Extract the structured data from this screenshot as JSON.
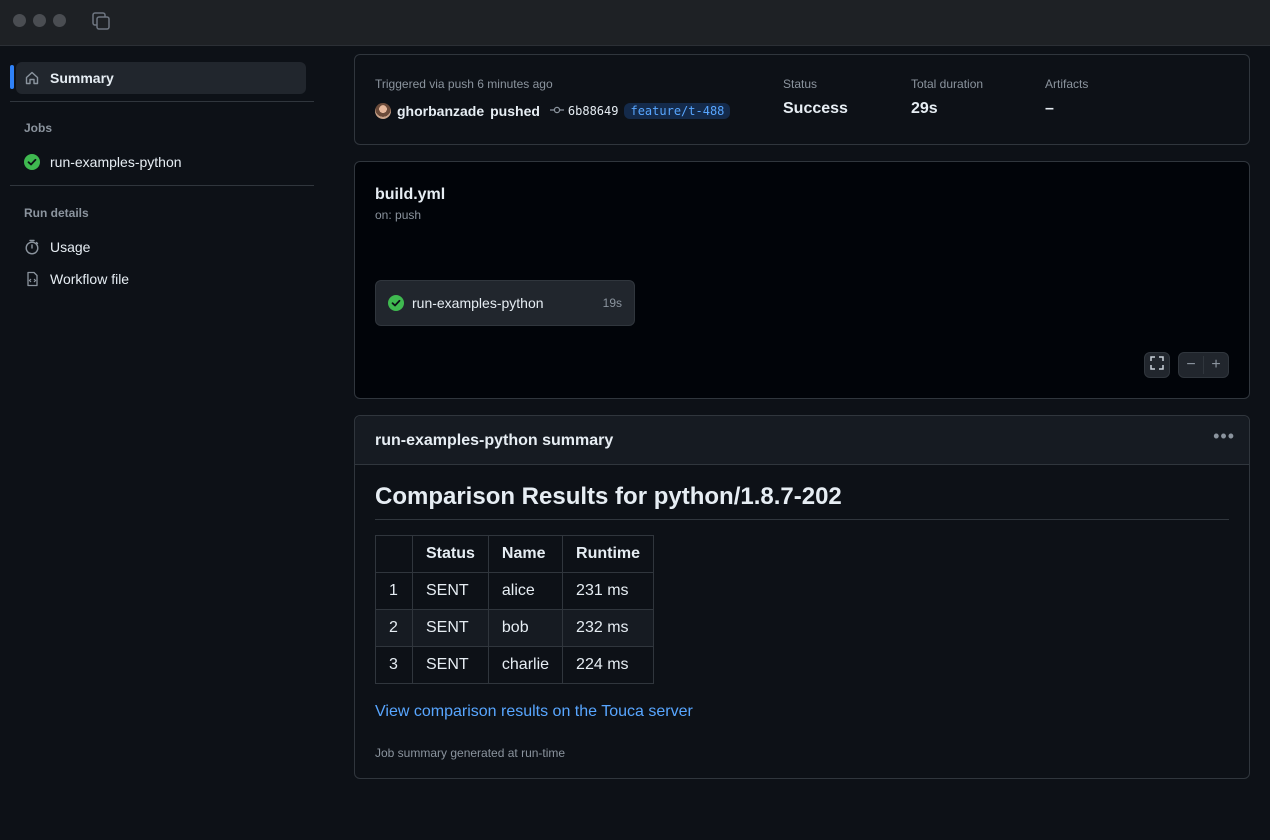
{
  "sidebar": {
    "summary_label": "Summary",
    "jobs_heading": "Jobs",
    "job_label": "run-examples-python",
    "run_details_heading": "Run details",
    "usage_label": "Usage",
    "workflow_file_label": "Workflow file"
  },
  "run_info": {
    "triggered": "Triggered via push 6 minutes ago",
    "user": "ghorbanzade",
    "action": "pushed",
    "commit": "6b88649",
    "branch": "feature/t-488",
    "status_label": "Status",
    "status_value": "Success",
    "duration_label": "Total duration",
    "duration_value": "29s",
    "artifacts_label": "Artifacts",
    "artifacts_value": "–"
  },
  "workflow": {
    "file": "build.yml",
    "trigger": "on: push",
    "job_name": "run-examples-python",
    "job_duration": "19s",
    "zoom_out": "−",
    "zoom_in": "+"
  },
  "summary": {
    "header": "run-examples-python summary",
    "heading": "Comparison Results for python/1.8.7-202",
    "columns": [
      "",
      "Status",
      "Name",
      "Runtime"
    ],
    "rows": [
      [
        "1",
        "SENT",
        "alice",
        "231 ms"
      ],
      [
        "2",
        "SENT",
        "bob",
        "232 ms"
      ],
      [
        "3",
        "SENT",
        "charlie",
        "224 ms"
      ]
    ],
    "link": "View comparison results on the Touca server",
    "footer": "Job summary generated at run-time"
  },
  "colors": {
    "accent": "#2f81f7",
    "success": "#3fb950",
    "link": "#58a6ff",
    "background": "#0d1117"
  }
}
